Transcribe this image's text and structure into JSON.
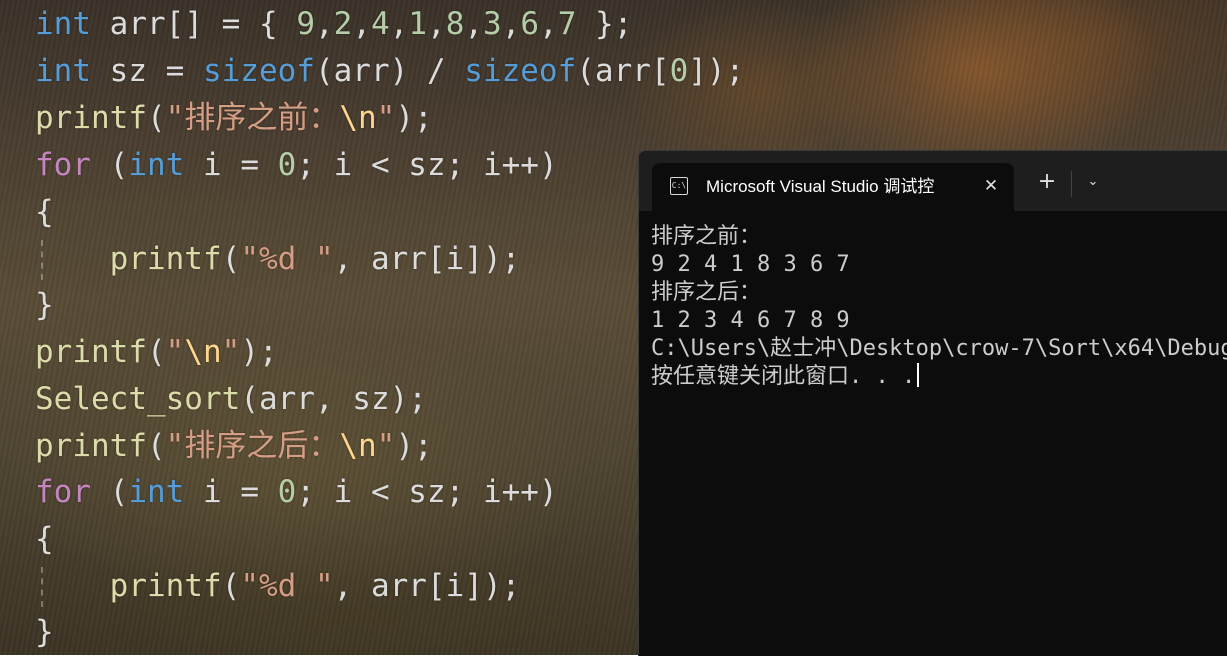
{
  "editor": {
    "lines": [
      [
        {
          "c": "kw",
          "t": "int"
        },
        {
          "c": "pl",
          "t": " arr[] = { "
        },
        {
          "c": "num",
          "t": "9"
        },
        {
          "c": "pl",
          "t": ","
        },
        {
          "c": "num",
          "t": "2"
        },
        {
          "c": "pl",
          "t": ","
        },
        {
          "c": "num",
          "t": "4"
        },
        {
          "c": "pl",
          "t": ","
        },
        {
          "c": "num",
          "t": "1"
        },
        {
          "c": "pl",
          "t": ","
        },
        {
          "c": "num",
          "t": "8"
        },
        {
          "c": "pl",
          "t": ","
        },
        {
          "c": "num",
          "t": "3"
        },
        {
          "c": "pl",
          "t": ","
        },
        {
          "c": "num",
          "t": "6"
        },
        {
          "c": "pl",
          "t": ","
        },
        {
          "c": "num",
          "t": "7"
        },
        {
          "c": "pl",
          "t": " };"
        }
      ],
      [
        {
          "c": "kw",
          "t": "int"
        },
        {
          "c": "pl",
          "t": " sz = "
        },
        {
          "c": "kw",
          "t": "sizeof"
        },
        {
          "c": "pl",
          "t": "(arr) / "
        },
        {
          "c": "kw",
          "t": "sizeof"
        },
        {
          "c": "pl",
          "t": "(arr["
        },
        {
          "c": "num",
          "t": "0"
        },
        {
          "c": "pl",
          "t": "]);"
        }
      ],
      [
        {
          "c": "fn",
          "t": "printf"
        },
        {
          "c": "pl",
          "t": "("
        },
        {
          "c": "str",
          "t": "\"排序之前："
        },
        {
          "c": "esc",
          "t": "\\n"
        },
        {
          "c": "str",
          "t": "\""
        },
        {
          "c": "pl",
          "t": ");"
        }
      ],
      [
        {
          "c": "ctl",
          "t": "for"
        },
        {
          "c": "pl",
          "t": " ("
        },
        {
          "c": "kw",
          "t": "int"
        },
        {
          "c": "pl",
          "t": " i = "
        },
        {
          "c": "num",
          "t": "0"
        },
        {
          "c": "pl",
          "t": "; i < sz; i++)"
        }
      ],
      [
        {
          "c": "pl",
          "t": "{"
        }
      ],
      [
        {
          "c": "pl",
          "t": "    "
        },
        {
          "c": "fn",
          "t": "printf"
        },
        {
          "c": "pl",
          "t": "("
        },
        {
          "c": "str",
          "t": "\"%d \""
        },
        {
          "c": "pl",
          "t": ", arr[i]);"
        }
      ],
      [
        {
          "c": "pl",
          "t": "}"
        }
      ],
      [
        {
          "c": "fn",
          "t": "printf"
        },
        {
          "c": "pl",
          "t": "("
        },
        {
          "c": "str",
          "t": "\""
        },
        {
          "c": "esc",
          "t": "\\n"
        },
        {
          "c": "str",
          "t": "\""
        },
        {
          "c": "pl",
          "t": ");"
        }
      ],
      [
        {
          "c": "fn",
          "t": "Select_sort"
        },
        {
          "c": "pl",
          "t": "(arr, sz);"
        }
      ],
      [
        {
          "c": "fn",
          "t": "printf"
        },
        {
          "c": "pl",
          "t": "("
        },
        {
          "c": "str",
          "t": "\"排序之后："
        },
        {
          "c": "esc",
          "t": "\\n"
        },
        {
          "c": "str",
          "t": "\""
        },
        {
          "c": "pl",
          "t": ");"
        }
      ],
      [
        {
          "c": "ctl",
          "t": "for"
        },
        {
          "c": "pl",
          "t": " ("
        },
        {
          "c": "kw",
          "t": "int"
        },
        {
          "c": "pl",
          "t": " i = "
        },
        {
          "c": "num",
          "t": "0"
        },
        {
          "c": "pl",
          "t": "; i < sz; i++)"
        }
      ],
      [
        {
          "c": "pl",
          "t": "{"
        }
      ],
      [
        {
          "c": "pl",
          "t": "    "
        },
        {
          "c": "fn",
          "t": "printf"
        },
        {
          "c": "pl",
          "t": "("
        },
        {
          "c": "str",
          "t": "\"%d \""
        },
        {
          "c": "pl",
          "t": ", arr[i]);"
        }
      ],
      [
        {
          "c": "pl",
          "t": "}"
        }
      ]
    ]
  },
  "terminal": {
    "tab_icon_text": "C:\\",
    "tab_title": "Microsoft Visual Studio 调试控",
    "close_glyph": "✕",
    "new_tab_glyph": "+",
    "dropdown_glyph": "⌄",
    "output": [
      "排序之前：",
      "9 2 4 1 8 3 6 7",
      "排序之后：",
      "1 2 3 4 6 7 8 9",
      "C:\\Users\\赵士冲\\Desktop\\crow-7\\Sort\\x64\\Debug",
      "按任意键关闭此窗口. . ."
    ]
  },
  "colors": {
    "keyword": "#569cd6",
    "control": "#c586c0",
    "function": "#dcdcaa",
    "number": "#b5cea8",
    "string": "#d69d85",
    "escape": "#ffd68f",
    "terminal_bg": "#0c0c0c"
  }
}
